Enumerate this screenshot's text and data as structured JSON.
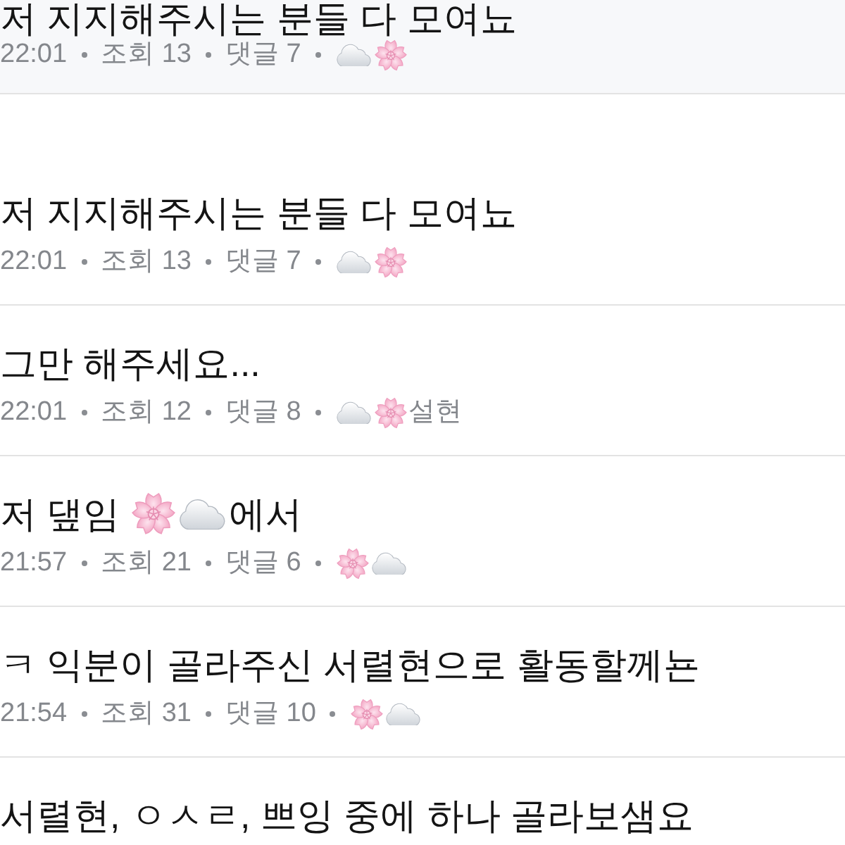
{
  "pinned_posts": [
    {
      "title": [
        {
          "kind": "text",
          "text": "저 지지해주시는 분들 다 모여뇨"
        }
      ],
      "time": "22:01",
      "views": "조회 13",
      "comments": "댓글 7",
      "author": [
        {
          "kind": "cloud"
        },
        {
          "kind": "blossom"
        }
      ]
    }
  ],
  "posts": [
    {
      "title": [
        {
          "kind": "text",
          "text": "저 지지해주시는 분들 다 모여뇨"
        }
      ],
      "time": "22:01",
      "views": "조회 13",
      "comments": "댓글 7",
      "author": [
        {
          "kind": "cloud"
        },
        {
          "kind": "blossom"
        }
      ]
    },
    {
      "title": [
        {
          "kind": "text",
          "text": "그만 해주세요..."
        }
      ],
      "time": "22:01",
      "views": "조회 12",
      "comments": "댓글 8",
      "author": [
        {
          "kind": "cloud"
        },
        {
          "kind": "blossom"
        },
        {
          "kind": "text",
          "text": "설현"
        }
      ]
    },
    {
      "title": [
        {
          "kind": "text",
          "text": "저 댚임 "
        },
        {
          "kind": "blossom"
        },
        {
          "kind": "cloud"
        },
        {
          "kind": "text",
          "text": "에서"
        }
      ],
      "time": "21:57",
      "views": "조회 21",
      "comments": "댓글 6",
      "author": [
        {
          "kind": "blossom"
        },
        {
          "kind": "cloud"
        }
      ]
    },
    {
      "title": [
        {
          "kind": "text",
          "text": "ㅋ 익분이 골라주신 서렬현으로 활동할께뇬"
        }
      ],
      "time": "21:54",
      "views": "조회 31",
      "comments": "댓글 10",
      "author": [
        {
          "kind": "blossom"
        },
        {
          "kind": "cloud"
        }
      ]
    },
    {
      "title": [
        {
          "kind": "text",
          "text": "서렬현, ㅇㅅㄹ, 쁘잉 중에 하나 골라보샘요"
        }
      ]
    }
  ]
}
